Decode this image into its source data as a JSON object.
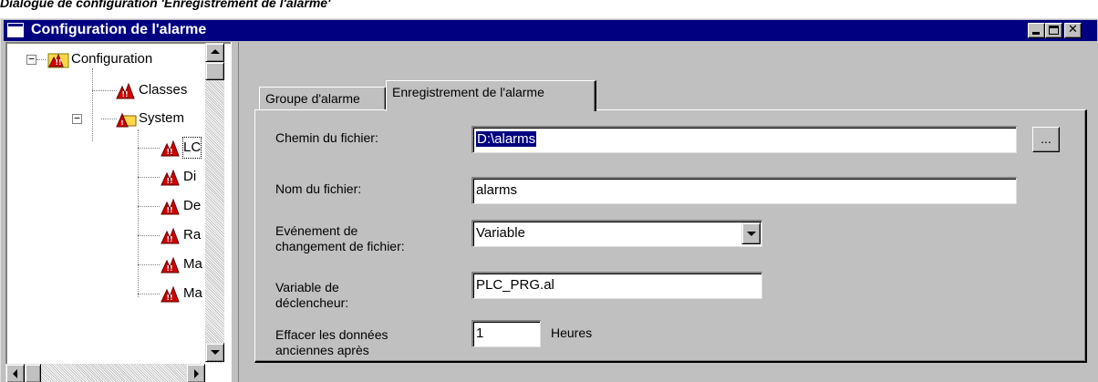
{
  "caption": "Dialogue de configuration 'Enregistrement de l'alarme'",
  "window": {
    "title": "Configuration de l'alarme",
    "controls": {
      "minimize": "_",
      "maximize": "□",
      "close": "✕"
    }
  },
  "tree": {
    "root": {
      "label": "Configuration",
      "expander": "−"
    },
    "classes": {
      "label": "Classes"
    },
    "system": {
      "label": "System",
      "expander": "−"
    },
    "children": [
      {
        "label": "LC"
      },
      {
        "label": "Di"
      },
      {
        "label": "De"
      },
      {
        "label": "Ra"
      },
      {
        "label": "Ma"
      },
      {
        "label": "Ma"
      }
    ]
  },
  "tabs": {
    "group": "Groupe d'alarme",
    "recording": "Enregistrement de l'alarme"
  },
  "form": {
    "file_path": {
      "label": "Chemin du fichier:",
      "value": "D:\\alarms",
      "browse": "..."
    },
    "file_name": {
      "label": "Nom du fichier:",
      "value": "alarms"
    },
    "change_event": {
      "label_1": "Evénement de",
      "label_2": "changement de fichier:",
      "value": "Variable"
    },
    "trigger_var": {
      "label_1": "Variable de",
      "label_2": "déclencheur:",
      "value": "PLC_PRG.al"
    },
    "delete_old": {
      "label_1": "Effacer les données",
      "label_2": "anciennes après",
      "value": "1",
      "unit": "Heures"
    }
  },
  "colors": {
    "title_bar": "#000080",
    "face": "#c0c0c0",
    "alarm_red": "#d00000",
    "folder_yellow": "#ffd84a"
  },
  "icons": {
    "alarm": "alarm-triangle-icon",
    "folder": "alarm-folder-icon"
  }
}
